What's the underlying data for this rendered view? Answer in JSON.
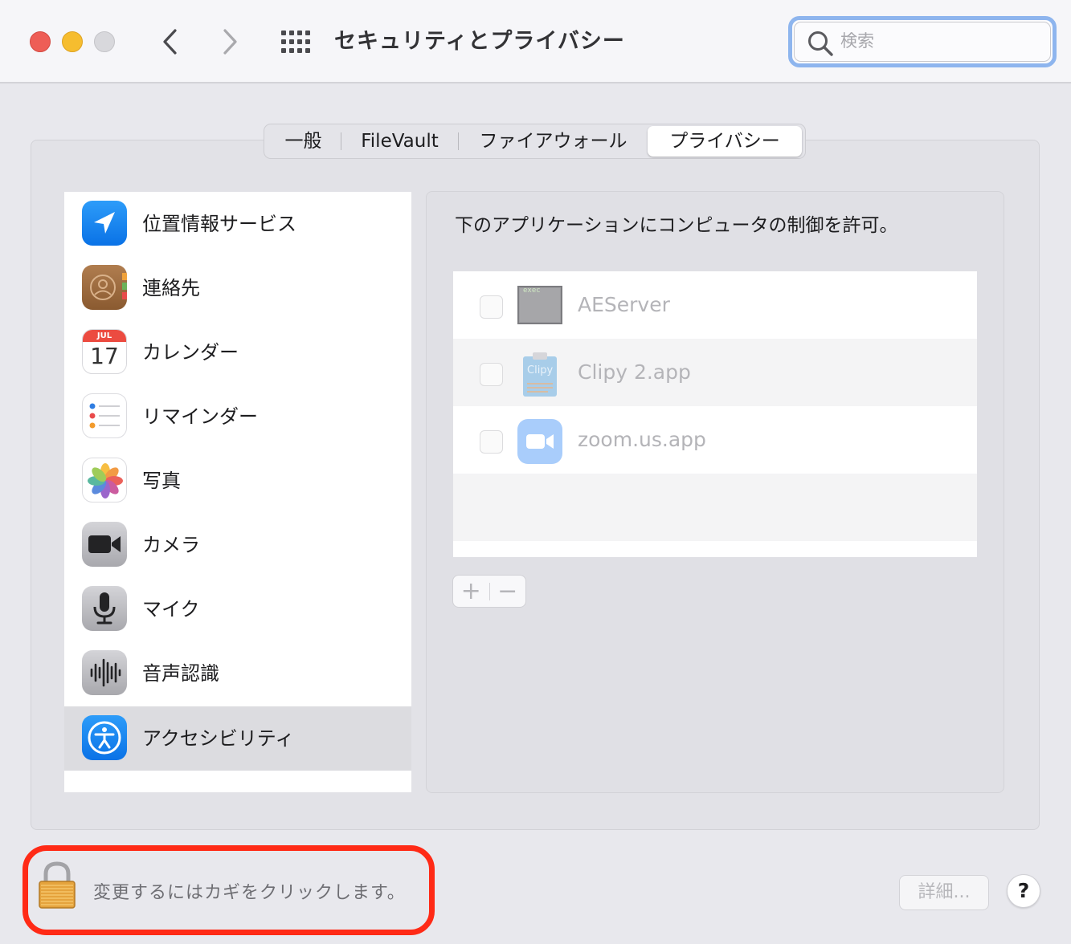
{
  "window": {
    "title": "セキュリティとプライバシー",
    "search_placeholder": "検索"
  },
  "tabs": [
    {
      "label": "一般",
      "active": false
    },
    {
      "label": "FileVault",
      "active": false
    },
    {
      "label": "ファイアウォール",
      "active": false
    },
    {
      "label": "プライバシー",
      "active": true
    }
  ],
  "sidebar": {
    "items": [
      {
        "label": "位置情報サービス",
        "icon": "location-arrow-icon"
      },
      {
        "label": "連絡先",
        "icon": "contacts-icon"
      },
      {
        "label": "カレンダー",
        "icon": "calendar-icon",
        "calendar_month": "JUL",
        "calendar_day": "17"
      },
      {
        "label": "リマインダー",
        "icon": "reminders-icon"
      },
      {
        "label": "写真",
        "icon": "photos-icon"
      },
      {
        "label": "カメラ",
        "icon": "camera-icon"
      },
      {
        "label": "マイク",
        "icon": "microphone-icon"
      },
      {
        "label": "音声認識",
        "icon": "speech-recognition-icon"
      },
      {
        "label": "アクセシビリティ",
        "icon": "accessibility-icon",
        "selected": true
      }
    ]
  },
  "content": {
    "title": "下のアプリケーションにコンピュータの制御を許可。",
    "apps": [
      {
        "name": "AEServer",
        "icon": "terminal-exec-icon",
        "icon_text": "exec",
        "checked": false
      },
      {
        "name": "Clipy 2.app",
        "icon": "clipy-icon",
        "icon_text": "Clipy",
        "checked": false
      },
      {
        "name": "zoom.us.app",
        "icon": "zoom-icon",
        "checked": false
      }
    ],
    "add_label": "+",
    "remove_label": "−"
  },
  "footer": {
    "lock_text": "変更するにはカギをクリックします。",
    "advanced_label": "詳細...",
    "help_label": "?"
  },
  "colors": {
    "highlight_border": "#ff2a16",
    "search_focus": "#8eb5ee",
    "accessibility_blue": "#1a8cf0"
  }
}
